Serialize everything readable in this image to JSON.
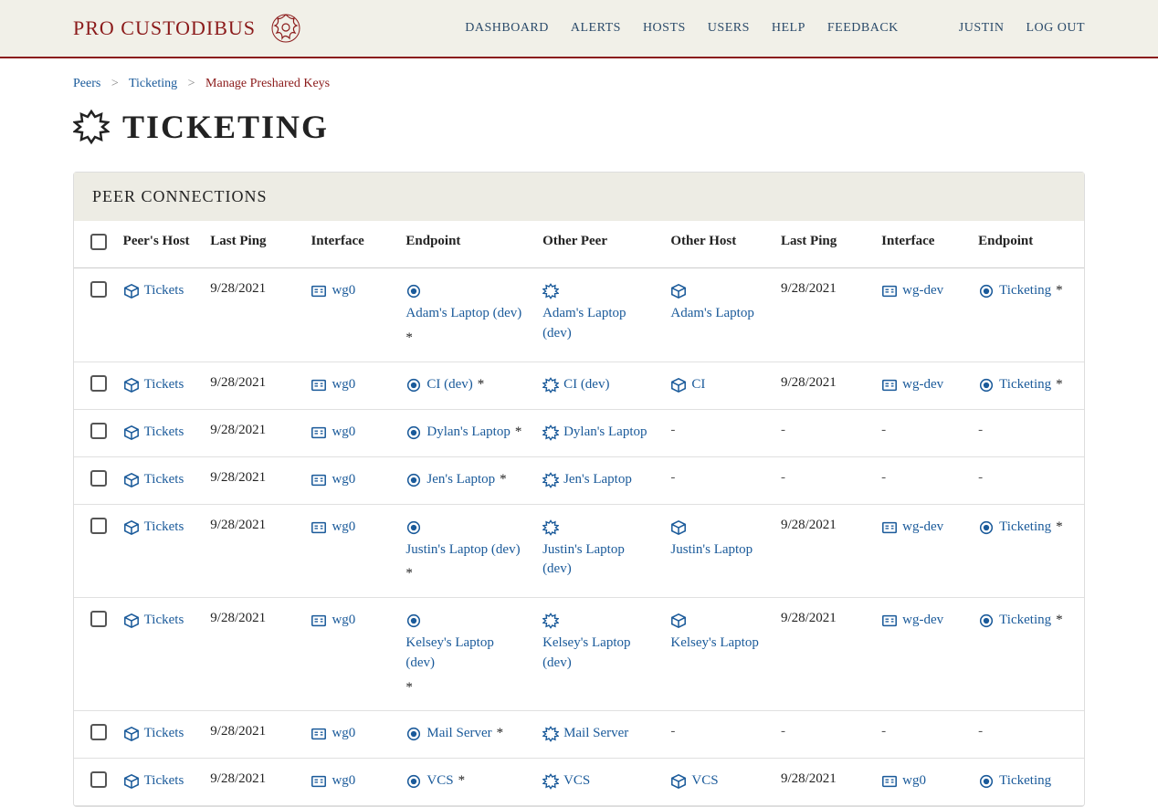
{
  "brand": "PRO CUSTODIBUS",
  "nav": {
    "dashboard": "DASHBOARD",
    "alerts": "ALERTS",
    "hosts": "HOSTS",
    "users": "USERS",
    "help": "HELP",
    "feedback": "FEEDBACK",
    "user": "JUSTIN",
    "logout": "LOG OUT"
  },
  "breadcrumb": {
    "peers": "Peers",
    "ticketing": "Ticketing",
    "current": "Manage Preshared Keys",
    "sep": ">"
  },
  "page_title": "TICKETING",
  "panel_title": "PEER CONNECTIONS",
  "columns": {
    "host1": "Peer's Host",
    "ping1": "Last Ping",
    "if1": "Interface",
    "ep1": "Endpoint",
    "peer": "Other Peer",
    "host2": "Other Host",
    "ping2": "Last Ping",
    "if2": "Interface",
    "ep2": "Endpoint"
  },
  "rows": [
    {
      "host1": "Tickets",
      "ping1": "9/28/2021",
      "if1": "wg0",
      "ep1": "Adam's Laptop (dev)",
      "ep1_psk": true,
      "peer": "Adam's Laptop (dev)",
      "host2": "Adam's Laptop",
      "ping2": "9/28/2021",
      "if2": "wg-dev",
      "ep2": "Ticketing",
      "ep2_psk": true
    },
    {
      "host1": "Tickets",
      "ping1": "9/28/2021",
      "if1": "wg0",
      "ep1": "CI (dev)",
      "ep1_psk": true,
      "peer": "CI (dev)",
      "host2": "CI",
      "ping2": "9/28/2021",
      "if2": "wg-dev",
      "ep2": "Ticketing",
      "ep2_psk": true
    },
    {
      "host1": "Tickets",
      "ping1": "9/28/2021",
      "if1": "wg0",
      "ep1": "Dylan's Laptop",
      "ep1_psk": true,
      "peer": "Dylan's Laptop",
      "host2": "-",
      "ping2": "-",
      "if2": "-",
      "ep2": "-"
    },
    {
      "host1": "Tickets",
      "ping1": "9/28/2021",
      "if1": "wg0",
      "ep1": "Jen's Laptop",
      "ep1_psk": true,
      "peer": "Jen's Laptop",
      "host2": "-",
      "ping2": "-",
      "if2": "-",
      "ep2": "-"
    },
    {
      "host1": "Tickets",
      "ping1": "9/28/2021",
      "if1": "wg0",
      "ep1": "Justin's Laptop (dev)",
      "ep1_psk": true,
      "peer": "Justin's Laptop (dev)",
      "host2": "Justin's Laptop",
      "ping2": "9/28/2021",
      "if2": "wg-dev",
      "ep2": "Ticketing",
      "ep2_psk": true
    },
    {
      "host1": "Tickets",
      "ping1": "9/28/2021",
      "if1": "wg0",
      "ep1": "Kelsey's Laptop (dev)",
      "ep1_psk": true,
      "peer": "Kelsey's Laptop (dev)",
      "host2": "Kelsey's Laptop",
      "ping2": "9/28/2021",
      "if2": "wg-dev",
      "ep2": "Ticketing",
      "ep2_psk": true
    },
    {
      "host1": "Tickets",
      "ping1": "9/28/2021",
      "if1": "wg0",
      "ep1": "Mail Server",
      "ep1_psk": true,
      "peer": "Mail Server",
      "host2": "-",
      "ping2": "-",
      "if2": "-",
      "ep2": "-"
    },
    {
      "host1": "Tickets",
      "ping1": "9/28/2021",
      "if1": "wg0",
      "ep1": "VCS",
      "ep1_psk": true,
      "peer": "VCS",
      "host2": "VCS",
      "ping2": "9/28/2021",
      "if2": "wg0",
      "ep2": "Ticketing",
      "ep2_psk": false
    }
  ]
}
